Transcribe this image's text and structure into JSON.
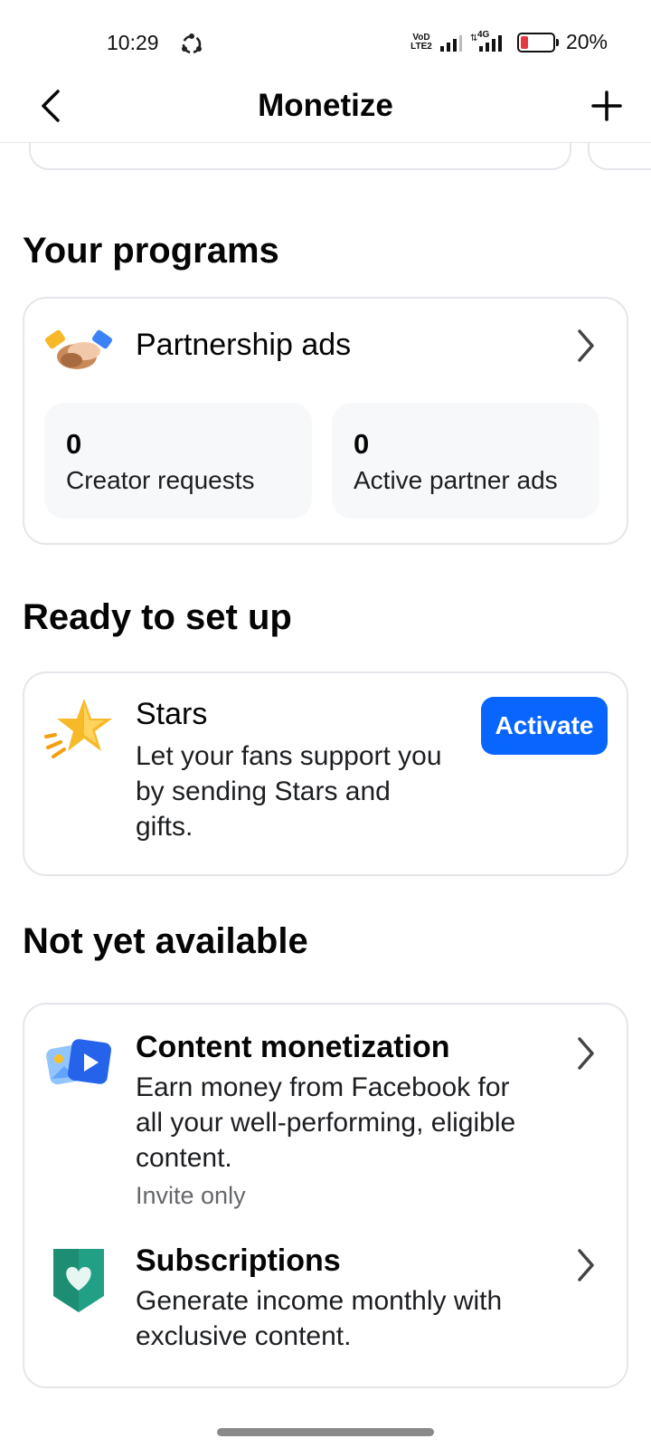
{
  "status_bar": {
    "time": "10:29",
    "volte_line1": "VoD",
    "volte_line2": "LTE2",
    "network": "4G",
    "battery_percent_label": "20%",
    "battery_level": 0.2,
    "battery_color": "#e5393d"
  },
  "header": {
    "title": "Monetize",
    "back_icon": "chevron-left-icon",
    "add_icon": "plus-icon"
  },
  "your_programs": {
    "section_title": "Your programs",
    "partnership": {
      "title": "Partnership ads",
      "icon": "handshake-icon",
      "stats": [
        {
          "value": "0",
          "label": "Creator requests"
        },
        {
          "value": "0",
          "label": "Active partner ads"
        }
      ]
    }
  },
  "ready_to_set_up": {
    "section_title": "Ready to set up",
    "stars": {
      "title": "Stars",
      "description": "Let your fans support you by sending Stars and gifts.",
      "button_label": "Activate",
      "icon": "star-icon"
    }
  },
  "not_yet_available": {
    "section_title": "Not yet available",
    "items": [
      {
        "title": "Content monetization",
        "description": "Earn money from Facebook for all your well-performing, eligible content.",
        "subtext": "Invite only",
        "icon": "media-content-icon"
      },
      {
        "title": "Subscriptions",
        "description": "Generate income monthly with exclusive content.",
        "icon": "heart-badge-icon"
      }
    ]
  },
  "colors": {
    "accent": "#0866ff",
    "border": "#e4e6eb",
    "stat_bg": "#f7f8fa",
    "secondary_text": "#65676b"
  }
}
